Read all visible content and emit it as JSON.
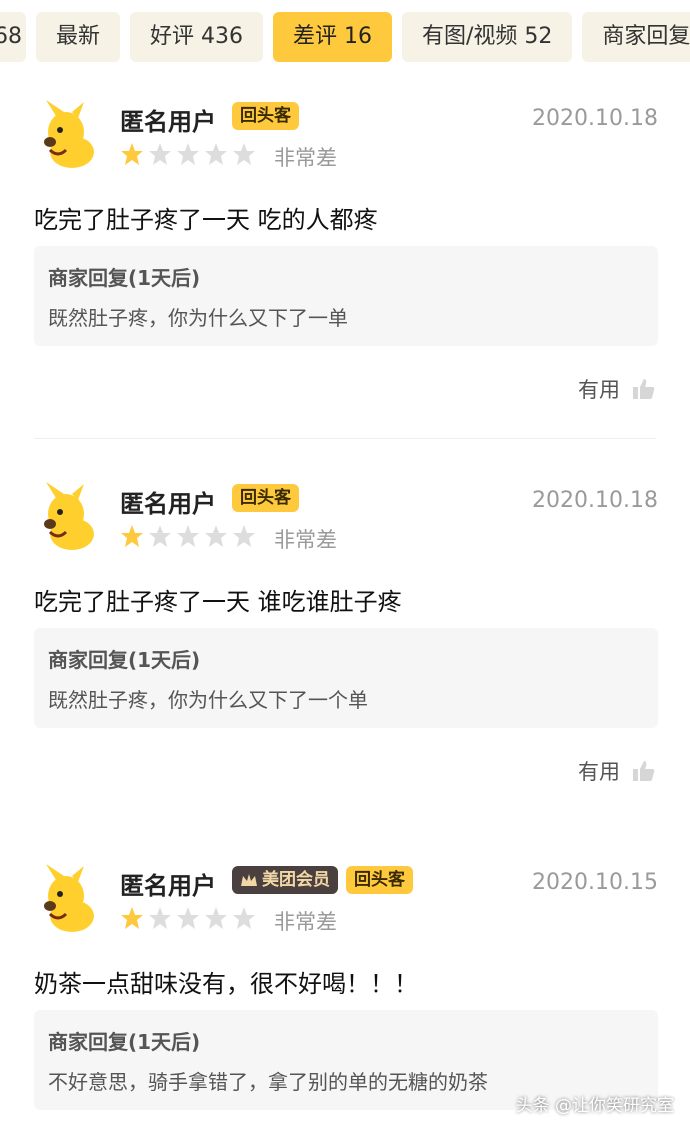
{
  "tabs": [
    {
      "label": "68",
      "active": false
    },
    {
      "label": "最新",
      "active": false
    },
    {
      "label": "好评 436",
      "active": false
    },
    {
      "label": "差评 16",
      "active": true
    },
    {
      "label": "有图/视频 52",
      "active": false
    },
    {
      "label": "商家回复",
      "active": false
    }
  ],
  "reviews": [
    {
      "username": "匿名用户",
      "badge_return": "回头客",
      "date": "2020.10.18",
      "stars": 1,
      "rating_text": "非常差",
      "content": "吃完了肚子疼了一天  吃的人都疼",
      "reply_title": "商家回复(1天后)",
      "reply_text": "既然肚子疼，你为什么又下了一单",
      "useful_label": "有用"
    },
    {
      "username": "匿名用户",
      "badge_return": "回头客",
      "date": "2020.10.18",
      "stars": 1,
      "rating_text": "非常差",
      "content": "吃完了肚子疼了一天  谁吃谁肚子疼",
      "reply_title": "商家回复(1天后)",
      "reply_text": "既然肚子疼，你为什么又下了一个单",
      "useful_label": "有用"
    },
    {
      "username": "匿名用户",
      "badge_member": "美团会员",
      "badge_return": "回头客",
      "date": "2020.10.15",
      "stars": 1,
      "rating_text": "非常差",
      "content": "奶茶一点甜味没有，很不好喝！！！",
      "reply_title": "商家回复(1天后)",
      "reply_text": "不好意思，骑手拿错了，拿了别的单的无糖的奶茶"
    }
  ],
  "watermark": "头条 @让你笑研究室",
  "colors": {
    "accent": "#ffc93d",
    "tab_bg": "#f7f2e6",
    "star_on": "#ffc93d",
    "star_off": "#dddddd"
  }
}
